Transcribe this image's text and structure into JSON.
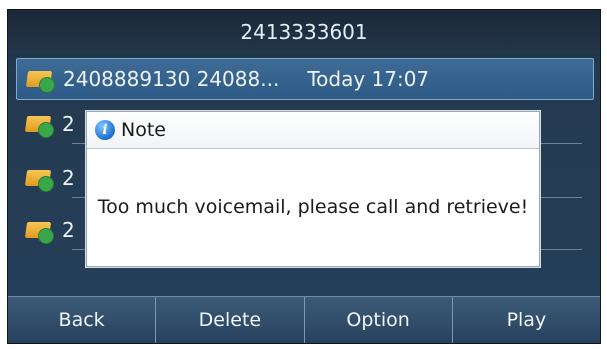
{
  "title": "2413333601",
  "list": [
    {
      "name": "2408889130 24088...",
      "time": "Today 17:07",
      "selected": true
    },
    {
      "prefix": "2",
      "selected": false
    },
    {
      "prefix": "2",
      "selected": false
    },
    {
      "prefix": "2",
      "selected": false
    }
  ],
  "dialog": {
    "title": "Note",
    "message": "Too much voicemail, please call and retrieve!",
    "icon": "info-icon"
  },
  "softkeys": {
    "back": "Back",
    "delete": "Delete",
    "option": "Option",
    "play": "Play"
  },
  "colors": {
    "screen_bg": "#26405a",
    "selected_row": "#2d5a86",
    "softkey_bg": "#27425e",
    "voicemail_envelope": "#e09a1e",
    "voicemail_badge": "#3aa64a"
  }
}
